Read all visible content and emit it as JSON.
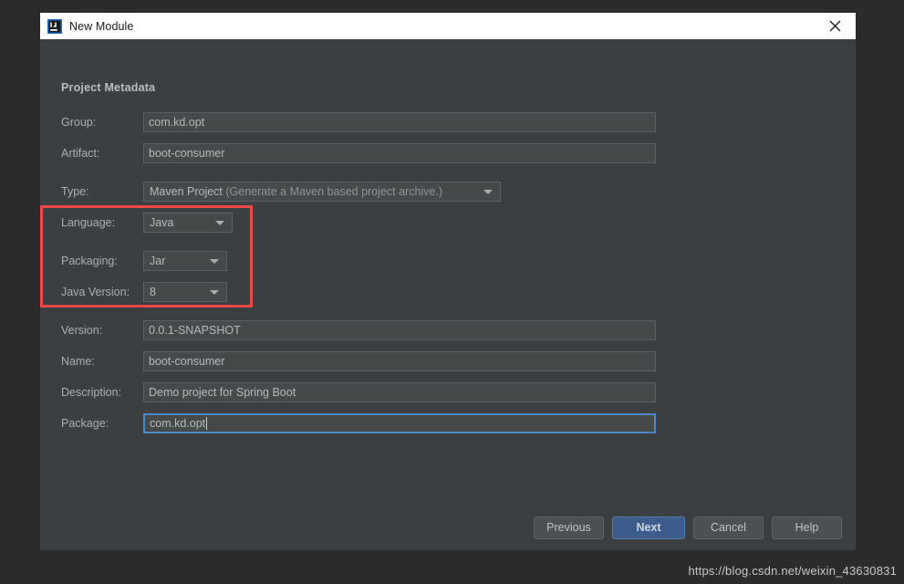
{
  "window": {
    "title": "New Module",
    "icon": "intellij-idea-icon",
    "close_icon": "close-icon",
    "titlebar_bg": "#ffffff",
    "body_bg": "#3c3f41",
    "desktop_bg": "#2b2b2b"
  },
  "section": {
    "heading": "Project Metadata"
  },
  "fields": {
    "group": {
      "label": "Group:",
      "value": "com.kd.opt",
      "type": "text"
    },
    "artifact": {
      "label": "Artifact:",
      "value": "boot-consumer",
      "type": "text"
    },
    "type": {
      "label": "Type:",
      "value": "Maven Project",
      "hint": "(Generate a Maven based project archive.)",
      "type": "combo"
    },
    "language": {
      "label": "Language:",
      "value": "Java",
      "type": "combo"
    },
    "packaging": {
      "label": "Packaging:",
      "value": "Jar",
      "type": "combo"
    },
    "java_version": {
      "label": "Java Version:",
      "value": "8",
      "type": "combo"
    },
    "version": {
      "label": "Version:",
      "value": "0.0.1-SNAPSHOT",
      "type": "text"
    },
    "name": {
      "label": "Name:",
      "value": "boot-consumer",
      "type": "text"
    },
    "description": {
      "label": "Description:",
      "value": "Demo project for Spring Boot",
      "type": "text"
    },
    "package": {
      "label": "Package:",
      "value": "com.kd.opt",
      "type": "text",
      "focused": true
    }
  },
  "annotation": {
    "kind": "red-rectangle-highlight",
    "color": "#ea4a45",
    "encloses": [
      "Language:",
      "Packaging:",
      "Java Version:"
    ]
  },
  "footer": {
    "previous_label": "Previous",
    "next_label": "Next",
    "cancel_label": "Cancel",
    "help_label": "Help",
    "primary_button": "Next",
    "primary_color": "#3c5c8b"
  },
  "watermark": {
    "text": "https://blog.csdn.net/weixin_43630831"
  }
}
